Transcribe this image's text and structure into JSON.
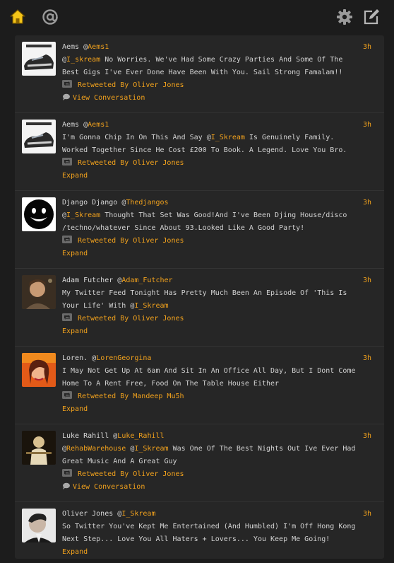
{
  "nav": {
    "home_icon": "home-icon",
    "mentions_icon": "at-icon",
    "settings_icon": "gear-icon",
    "compose_icon": "compose-icon",
    "accent": "#f2a21d"
  },
  "tweets": [
    {
      "name": "Aems",
      "at": "@",
      "username": "Aems1",
      "time": "3h",
      "text_parts": [
        {
          "t": "@",
          "m": false
        },
        {
          "t": "I_skream",
          "m": true
        },
        {
          "t": " No Worries. We've Had Some Crazy Parties And Some Of The Best Gigs I've Ever Done Have Been With You. Sail Strong Famalam!!",
          "m": false
        }
      ],
      "retweet": "Retweeted By Oliver Jones",
      "action": "View Conversation",
      "action_type": "conversation"
    },
    {
      "name": "Aems",
      "at": "@",
      "username": "Aems1",
      "time": "3h",
      "text_parts": [
        {
          "t": "I'm Gonna Chip In On This And Say @",
          "m": false
        },
        {
          "t": "I_Skream",
          "m": true
        },
        {
          "t": " Is Genuinely Family. Worked Together Since He Cost £200 To Book. A Legend. Love You Bro.",
          "m": false
        }
      ],
      "retweet": "Retweeted By Oliver Jones",
      "action": "Expand",
      "action_type": "expand"
    },
    {
      "name": "Django Django",
      "at": "@",
      "username": "Thedjangos",
      "time": "3h",
      "text_parts": [
        {
          "t": "@",
          "m": false
        },
        {
          "t": "I_Skream",
          "m": true
        },
        {
          "t": " Thought That Set Was Good!And I've Been Djing House/disco /techno/whatever Since About 93.Looked Like A Good Party!",
          "m": false
        }
      ],
      "retweet": "Retweeted By Oliver Jones",
      "action": "Expand",
      "action_type": "expand"
    },
    {
      "name": "Adam Futcher",
      "at": "@",
      "username": "Adam_Futcher",
      "time": "3h",
      "text_parts": [
        {
          "t": "My Twitter Feed Tonight Has Pretty Much Been An Episode Of 'This Is Your Life' With @",
          "m": false
        },
        {
          "t": "I_Skream",
          "m": true
        }
      ],
      "retweet": "Retweeted By Oliver Jones",
      "action": "Expand",
      "action_type": "expand"
    },
    {
      "name": "Loren.",
      "at": "@",
      "username": "LorenGeorgina",
      "time": "3h",
      "text_parts": [
        {
          "t": "I May Not Get Up At 6am And Sit In An Office All Day, But I Dont Come Home To A Rent Free, Food On The Table House Either",
          "m": false
        }
      ],
      "retweet": "Retweeted By Mandeep Mu5h",
      "action": "Expand",
      "action_type": "expand"
    },
    {
      "name": "Luke Rahill",
      "at": "@",
      "username": "Luke_Rahill",
      "time": "3h",
      "text_parts": [
        {
          "t": "@",
          "m": false
        },
        {
          "t": "RehabWarehouse",
          "m": true
        },
        {
          "t": " @",
          "m": false
        },
        {
          "t": "I_Skream",
          "m": true
        },
        {
          "t": " Was One Of The Best Nights Out Ive Ever Had Great Music And A Great Guy",
          "m": false
        }
      ],
      "retweet": "Retweeted By Oliver Jones",
      "action": "View Conversation",
      "action_type": "conversation"
    },
    {
      "name": "Oliver Jones",
      "at": "@",
      "username": "I_Skream",
      "time": "3h",
      "text_parts": [
        {
          "t": "So Twitter You've Kept Me Entertained (And Humbled) I'm Off Hong Kong Next Step... Love You All Haters + Lovers... You Keep Me Going!",
          "m": false
        }
      ],
      "retweet": "",
      "action": "Expand",
      "action_type": "expand"
    }
  ]
}
